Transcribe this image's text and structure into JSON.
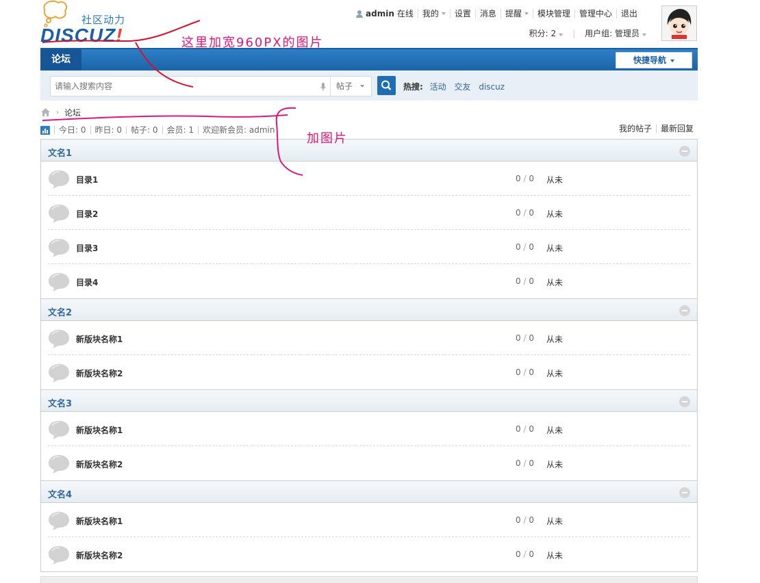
{
  "logo": {
    "tagline": "社区动力",
    "word_pre": "DISCUZ",
    "word_bang": "!"
  },
  "topnav": {
    "username": "admin",
    "online": "在线",
    "items": [
      "我的",
      "设置",
      "消息",
      "提醒",
      "模块管理",
      "管理中心",
      "退出"
    ]
  },
  "subnav": {
    "points": "积分: 2",
    "usergroup": "用户组: 管理员"
  },
  "nav": {
    "forum_tab": "论坛",
    "quick_nav": "快捷导航"
  },
  "search": {
    "placeholder": "请输入搜索内容",
    "type": "帖子",
    "hot_label": "热搜:",
    "hot": [
      "活动",
      "交友",
      "discuz"
    ]
  },
  "breadcrumb": {
    "current": "论坛"
  },
  "stats": {
    "items": [
      "今日: 0",
      "昨日: 0",
      "帖子: 0",
      "会员: 1",
      "欢迎新会员: admin"
    ],
    "links": [
      "我的帖子",
      "最新回复"
    ]
  },
  "categories": [
    {
      "title": "文名1",
      "forums": [
        {
          "name": "目录1",
          "threads": "0",
          "posts": "0",
          "last": "从未"
        },
        {
          "name": "目录2",
          "threads": "0",
          "posts": "0",
          "last": "从未"
        },
        {
          "name": "目录3",
          "threads": "0",
          "posts": "0",
          "last": "从未"
        },
        {
          "name": "目录4",
          "threads": "0",
          "posts": "0",
          "last": "从未"
        }
      ]
    },
    {
      "title": "文名2",
      "forums": [
        {
          "name": "新版块名称1",
          "threads": "0",
          "posts": "0",
          "last": "从未"
        },
        {
          "name": "新版块名称2",
          "threads": "0",
          "posts": "0",
          "last": "从未"
        }
      ]
    },
    {
      "title": "文名3",
      "forums": [
        {
          "name": "新版块名称1",
          "threads": "0",
          "posts": "0",
          "last": "从未"
        },
        {
          "name": "新版块名称2",
          "threads": "0",
          "posts": "0",
          "last": "从未"
        }
      ]
    },
    {
      "title": "文名4",
      "forums": [
        {
          "name": "新版块名称1",
          "threads": "0",
          "posts": "0",
          "last": "从未"
        },
        {
          "name": "新版块名称2",
          "threads": "0",
          "posts": "0",
          "last": "从未"
        }
      ]
    }
  ],
  "annotations": {
    "note1": "这里加宽960PX的图片",
    "note2": "加图片"
  },
  "colors": {
    "nav_blue": "#1a64a8",
    "annotation_pink": "#e0157a",
    "annotation_red": "#d9102a"
  }
}
